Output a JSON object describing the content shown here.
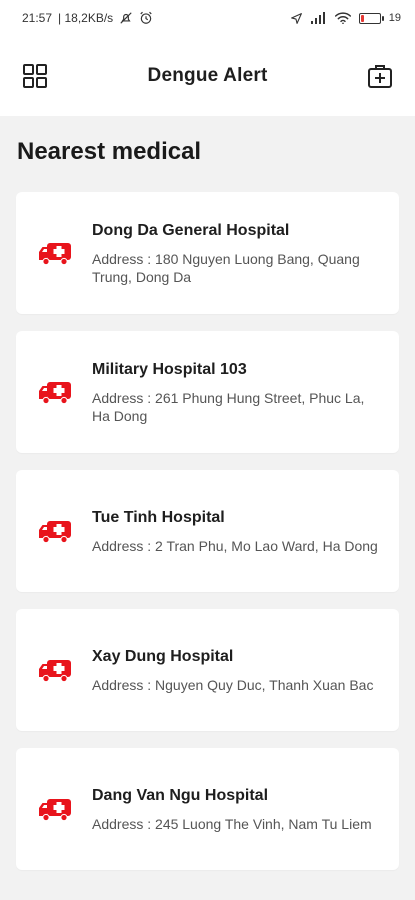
{
  "status_bar": {
    "time": "21:57",
    "speed": "| 18,2KB/s",
    "battery_text": "19",
    "battery_level": 0.19,
    "icons": [
      "mute-icon",
      "alarm-icon",
      "location-arrow-icon",
      "signal-icon",
      "wifi-icon",
      "battery-icon"
    ]
  },
  "header": {
    "title": "Dengue Alert",
    "left_icon": "grid-menu-icon",
    "right_icon": "medical-kit-icon"
  },
  "section_title": "Nearest medical",
  "accent_color": "#e8141c",
  "hospitals": [
    {
      "name": "Dong Da General Hospital",
      "address": "Address : 180 Nguyen Luong Bang, Quang Trung, Dong Da"
    },
    {
      "name": "Military Hospital 103",
      "address": "Address :  261 Phung Hung Street, Phuc La, Ha Dong"
    },
    {
      "name": "Tue Tinh Hospital",
      "address": "Address : 2 Tran Phu, Mo Lao Ward, Ha Dong"
    },
    {
      "name": "Xay Dung Hospital",
      "address": "Address : Nguyen Quy Duc, Thanh Xuan Bac"
    },
    {
      "name": "Dang Van Ngu Hospital",
      "address": "Address : 245 Luong The Vinh, Nam Tu Liem"
    }
  ]
}
